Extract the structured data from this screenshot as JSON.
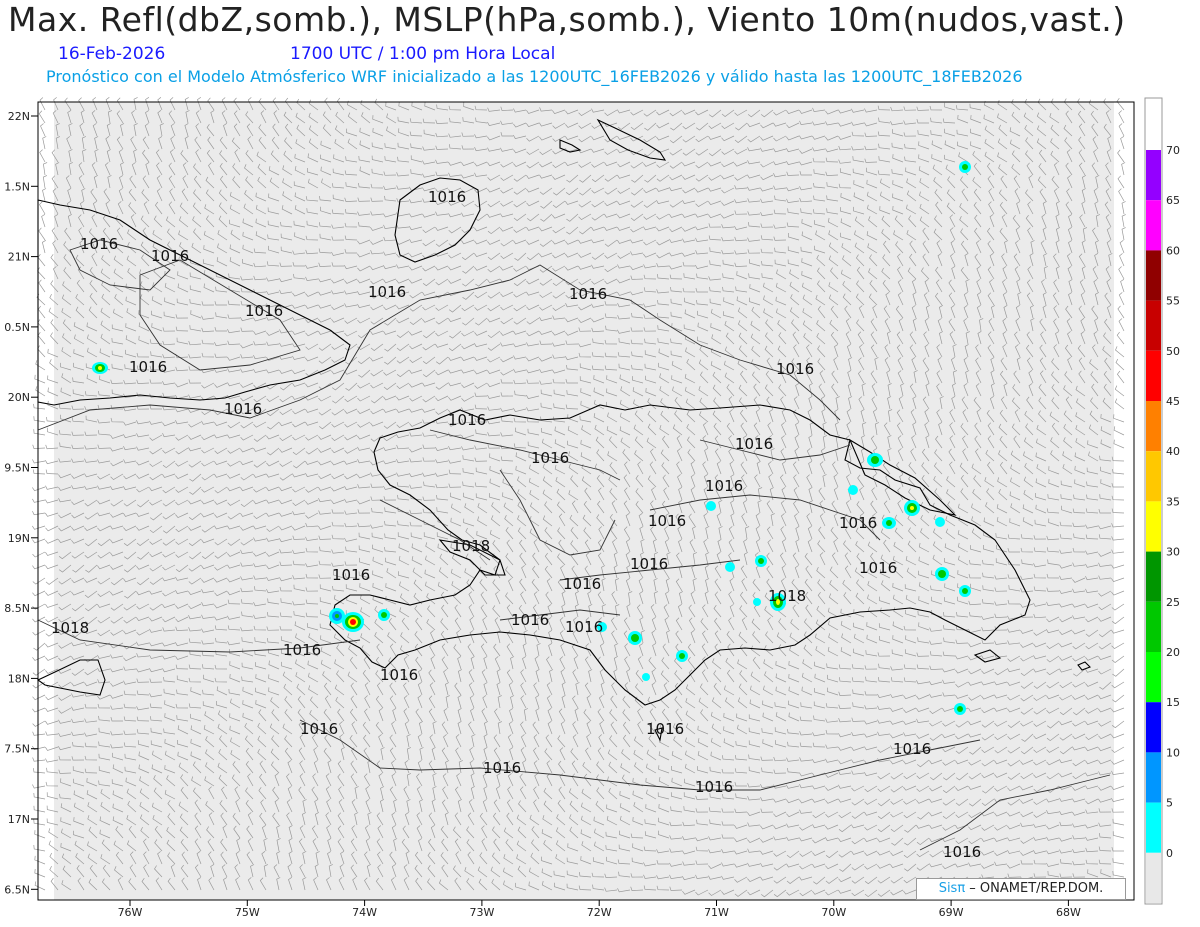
{
  "header": {
    "title": "Max. Refl(dbZ,somb.), MSLP(hPa,somb.), Viento 10m(nudos,vast.)",
    "date": "16-Feb-2026",
    "valid_time": "1700 UTC / 1:00 pm Hora Local",
    "model_info": "Pronóstico con el Modelo Atmósferico WRF inicializado a las 1200UTC_16FEB2026 y válido hasta las  1200UTC_18FEB2026"
  },
  "axes": {
    "lat_labels": [
      "22N",
      "1.5N",
      "21N",
      "0.5N",
      "20N",
      "9.5N",
      "19N",
      "8.5N",
      "18N",
      "7.5N",
      "17N",
      "6.5N"
    ],
    "lon_labels": [
      "76W",
      "75W",
      "74W",
      "73W",
      "72W",
      "71W",
      "70W",
      "69W",
      "68W"
    ]
  },
  "colorbar": {
    "labels": [
      "70",
      "65",
      "60",
      "55",
      "50",
      "45",
      "40",
      "35",
      "30",
      "25",
      "20",
      "15",
      "10",
      "5",
      "0"
    ],
    "colors": [
      "#9400ff",
      "#ff00ff",
      "#900000",
      "#c80000",
      "#ff0000",
      "#ff8000",
      "#ffc800",
      "#ffff00",
      "#009600",
      "#00c800",
      "#00ff00",
      "#0000ff",
      "#0096ff",
      "#00ffff",
      "#e8e8e8"
    ]
  },
  "isobar_labels": [
    "1016",
    "1016",
    "1016",
    "1016",
    "1016",
    "1016",
    "1016",
    "1016",
    "1016",
    "1016",
    "1016",
    "1016",
    "1016",
    "1016",
    "1016",
    "1018",
    "1016",
    "1016",
    "1016",
    "1018",
    "1016",
    "1016",
    "1016",
    "1016",
    "1016",
    "1018",
    "1016",
    "1016",
    "1016",
    "1016",
    "1016",
    "1016",
    "1016",
    "1016"
  ],
  "credit": {
    "logo": "Sis",
    "pi": "π",
    "text": " – ONAMET/REP.DOM."
  }
}
